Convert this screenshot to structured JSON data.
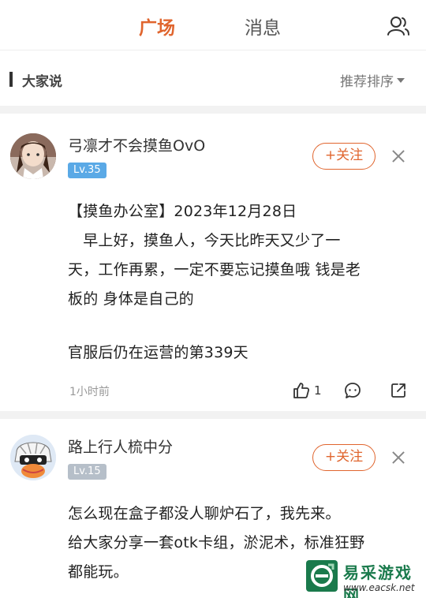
{
  "tabs": [
    {
      "label": "广场",
      "active": true
    },
    {
      "label": "消息",
      "active": false
    }
  ],
  "section": {
    "title": "大家说",
    "sort_label": "推荐排序"
  },
  "posts": [
    {
      "username": "弓凛才不会摸鱼OvO",
      "level": "Lv.35",
      "follow_label": "+关注",
      "lines": [
        "【摸鱼办公室】2023年12月28日",
        "　早上好，摸鱼人，今天比昨天又少了一",
        "天，工作再累，一定不要忘记摸鱼哦  钱是老",
        "板的 身体是自己的",
        "",
        "官服后仍在运营的第339天"
      ],
      "time": "1小时前",
      "like_count": "1"
    },
    {
      "username": "路上行人梳中分",
      "level": "Lv.15",
      "follow_label": "+关注",
      "lines": [
        "怎么现在盒子都没人聊炉石了，我先来。",
        "给大家分享一套otk卡组，淤泥术，标准狂野",
        "都能玩。"
      ]
    }
  ],
  "watermark": {
    "text": "易采游戏网",
    "url": "www.eacsk.net"
  },
  "colors": {
    "accent": "#e0652e",
    "level_blue": "#5aa9e6",
    "level_gray": "#b6bfc9"
  }
}
